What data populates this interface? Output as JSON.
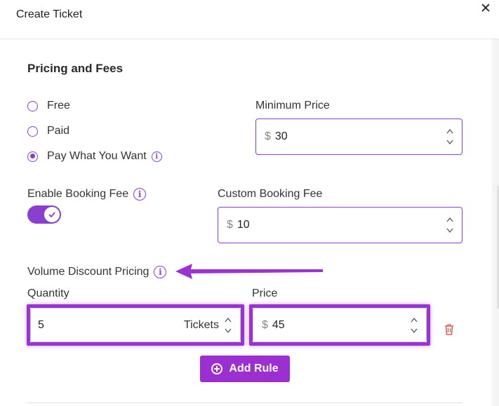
{
  "header": {
    "title": "Create Ticket",
    "close_glyph": "✕"
  },
  "pricing": {
    "section_title": "Pricing and Fees",
    "options": [
      {
        "label": "Free",
        "selected": false
      },
      {
        "label": "Paid",
        "selected": false
      },
      {
        "label": "Pay What You Want",
        "selected": true
      }
    ],
    "minimum_price": {
      "label": "Minimum Price",
      "currency": "$",
      "value": "30"
    }
  },
  "booking_fee": {
    "enable_label": "Enable Booking Fee",
    "enabled": true,
    "custom": {
      "label": "Custom Booking Fee",
      "currency": "$",
      "value": "10"
    }
  },
  "volume_discount": {
    "title": "Volume Discount Pricing",
    "quantity_label": "Quantity",
    "price_label": "Price",
    "rules": [
      {
        "quantity": "5",
        "unit": "Tickets",
        "currency": "$",
        "price": "45"
      }
    ],
    "add_rule_label": "Add Rule"
  },
  "icons": {
    "info": "info-icon",
    "close": "close-icon",
    "trash": "trash-icon",
    "check": "check-icon",
    "add": "plus-circle-icon"
  },
  "colors": {
    "accent": "#8a3fd1",
    "highlight": "#9b32d6",
    "button": "#9b2fd2",
    "trash": "#e05a4f"
  }
}
